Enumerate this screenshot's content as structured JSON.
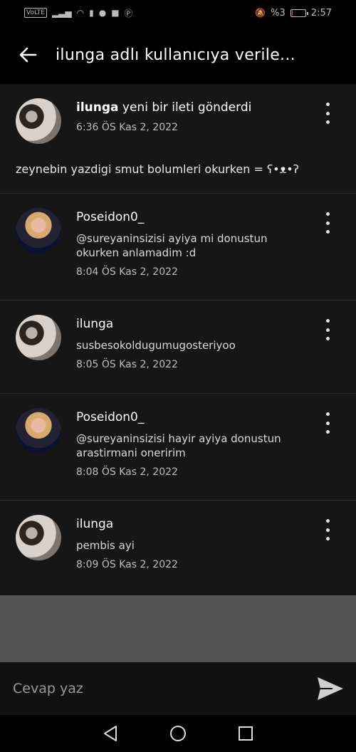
{
  "status_bar": {
    "volte": "VoLTE",
    "battery_percent": "%3",
    "time": "2:57",
    "battery_level": 0.03,
    "icons": [
      "signal-icon",
      "wifi-icon",
      "sim-icon",
      "app-icon",
      "teams-icon",
      "pinterest-icon",
      "mute-icon"
    ]
  },
  "header": {
    "title": "ilunga adlı kullanıcıya verile..."
  },
  "original_post": {
    "author": "ilunga",
    "action": " yeni bir ileti gönderdi",
    "time": "6:36 ÖS Kas 2, 2022",
    "body": "zeynebin yazdigi smut bolumleri okurken = ʕ•ᴥ•ʔ"
  },
  "replies": [
    {
      "author": "Poseidon0_",
      "text": "@sureyaninsizisi  ayiya mi donustun okurken anlamadim :d",
      "time": "8:04 ÖS Kas 2, 2022",
      "avatar": "poseidon"
    },
    {
      "author": "ilunga",
      "text": "susbesokoldugumugosteriyoo",
      "time": "8:05 ÖS Kas 2, 2022",
      "avatar": "couple"
    },
    {
      "author": "Poseidon0_",
      "text": "@sureyaninsizisi  hayir ayiya donustun arastirmani oneririm",
      "time": "8:08 ÖS Kas 2, 2022",
      "avatar": "poseidon"
    },
    {
      "author": "ilunga",
      "text": "pembis ayi",
      "time": "8:09 ÖS Kas 2, 2022",
      "avatar": "couple"
    }
  ],
  "composer": {
    "placeholder": "Cevap yaz"
  },
  "colors": {
    "background": "#000000",
    "list_bg": "#161616",
    "divider": "#2c2c2c",
    "battery_low": "#e23a3a"
  }
}
